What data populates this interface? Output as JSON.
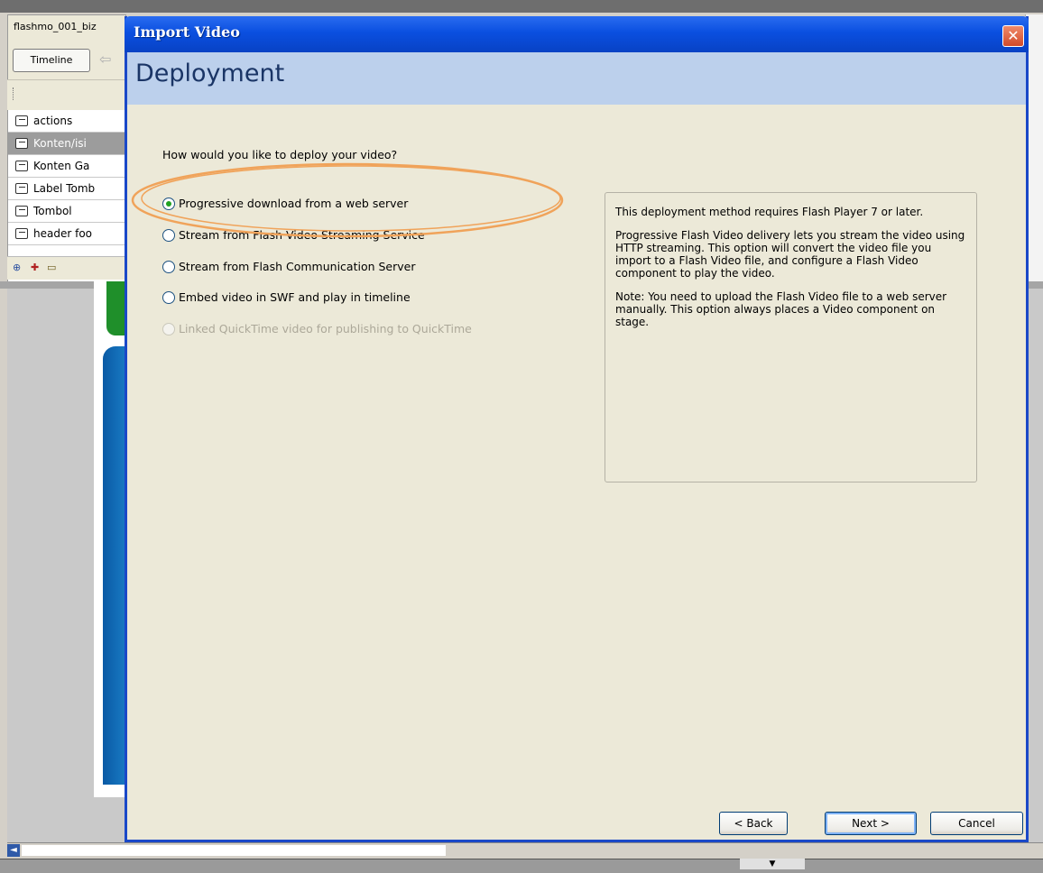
{
  "ide": {
    "document_tab": "flashmo_001_biz",
    "timeline_button": "Timeline",
    "layers": [
      {
        "name": "actions",
        "selected": false
      },
      {
        "name": "Konten/isi",
        "selected": true
      },
      {
        "name": "Konten Ga",
        "selected": false
      },
      {
        "name": "Label Tomb",
        "selected": false
      },
      {
        "name": "Tombol",
        "selected": false
      },
      {
        "name": "header foo",
        "selected": false
      }
    ],
    "layer_tool_icons": [
      "add-layer-icon",
      "add-motion-guide-icon",
      "insert-folder-icon"
    ],
    "scroll_left_icon": "scroll-left-arrow-icon",
    "bottom_control_icon": "chevron-down-icon",
    "bottom_ticks": "III"
  },
  "dialog": {
    "title": "Import Video",
    "close_icon": "close-icon",
    "step_title": "Deployment",
    "question": "How would you like to deploy your video?",
    "options": [
      {
        "label": "Progressive download from a web server",
        "checked": true,
        "disabled": false
      },
      {
        "label": "Stream from Flash Video Streaming Service",
        "checked": false,
        "disabled": false
      },
      {
        "label": "Stream from Flash Communication Server",
        "checked": false,
        "disabled": false
      },
      {
        "label": "Embed video in SWF and play in timeline",
        "checked": false,
        "disabled": false
      },
      {
        "label": "Linked QuickTime video for publishing to QuickTime",
        "checked": false,
        "disabled": true
      }
    ],
    "description": [
      "This deployment method requires Flash Player 7 or later.",
      "Progressive Flash Video delivery lets you stream the video using HTTP streaming. This option will convert the video file you import to a Flash Video file, and configure a Flash Video component to play the video.",
      "Note: You need to upload the Flash Video file to a web server manually.  This option always places a Video component on stage."
    ],
    "buttons": {
      "back": "< Back",
      "next": "Next >",
      "cancel": "Cancel"
    },
    "colors": {
      "titlebar": "#0a4fe0",
      "header_band": "#bcd0ec",
      "highlight_ellipse": "#f0a35a"
    }
  }
}
